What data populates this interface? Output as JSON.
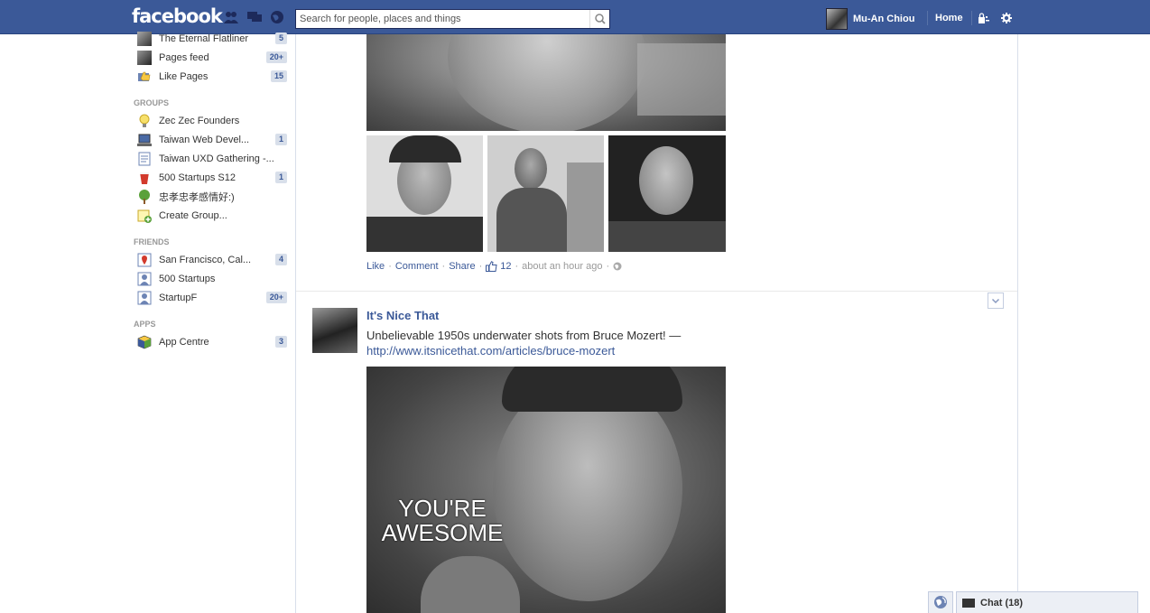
{
  "header": {
    "logo": "facebook",
    "search_placeholder": "Search for people, places and things",
    "user_name": "Mu-An Chiou",
    "home": "Home"
  },
  "sidebar": {
    "items_top": [
      {
        "label": "The Eternal Flatliner",
        "count": "5"
      },
      {
        "label": "Pages feed",
        "count": "20+"
      },
      {
        "label": "Like Pages",
        "count": "15"
      }
    ],
    "groups_heading": "GROUPS",
    "groups": [
      {
        "label": "Zec Zec Founders",
        "count": ""
      },
      {
        "label": "Taiwan Web Devel...",
        "count": "1"
      },
      {
        "label": "Taiwan UXD Gathering -...",
        "count": ""
      },
      {
        "label": "500 Startups S12",
        "count": "1"
      },
      {
        "label": "忠孝忠孝感情好:)",
        "count": ""
      },
      {
        "label": "Create Group...",
        "count": ""
      }
    ],
    "friends_heading": "FRIENDS",
    "friends": [
      {
        "label": "San Francisco, Cal...",
        "count": "4"
      },
      {
        "label": "500 Startups",
        "count": ""
      },
      {
        "label": "StartupF",
        "count": "20+"
      }
    ],
    "apps_heading": "APPS",
    "apps": [
      {
        "label": "App Centre",
        "count": "3"
      }
    ]
  },
  "story1": {
    "like": "Like",
    "comment": "Comment",
    "share": "Share",
    "likes_count": "12",
    "time": "about an hour ago"
  },
  "story2": {
    "page_name": "It's Nice That",
    "text": "Unbelievable 1950s underwater shots from Bruce Mozert! —",
    "link": "http://www.itsnicethat.com/articles/bruce-mozert",
    "image_caption": "YOU'RE AWESOME"
  },
  "chat": {
    "label": "Chat (18)"
  },
  "colors": {
    "brand": "#3b5998",
    "count_bg": "#d8dfea"
  }
}
